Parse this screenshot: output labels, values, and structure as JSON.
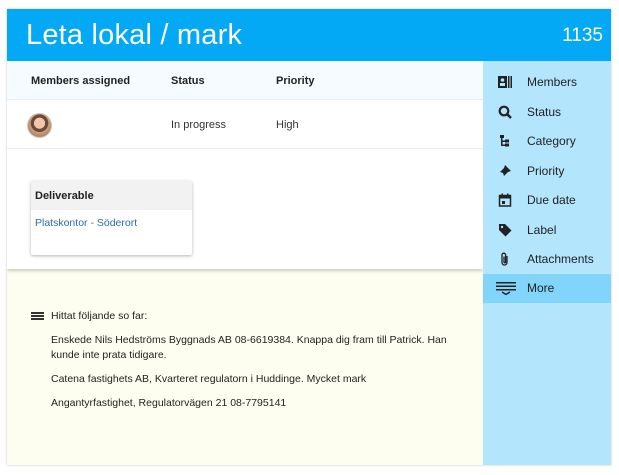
{
  "header": {
    "title": "Leta lokal / mark",
    "ticket_id": "1135"
  },
  "table": {
    "columns": [
      "Members assigned",
      "Status",
      "Priority"
    ],
    "row": {
      "status": "In progress",
      "priority": "High"
    }
  },
  "deliverable": {
    "heading": "Deliverable",
    "link": "Platskontor - Söderort"
  },
  "description": {
    "title": "Hittat följande so far:",
    "paragraphs": [
      "Enskede Nils Hedströms Byggnads AB 08-6619384. Knappa dig fram till Patrick. Han kunde inte prata tidigare.",
      "Catena fastighets AB, Kvarteret regulatorn i Huddinge. Mycket mark",
      "Angantyrfastighet, Regulatorvägen 21 08-7795141"
    ]
  },
  "sidebar": {
    "items": [
      {
        "label": "Members",
        "icon": "members-icon"
      },
      {
        "label": "Status",
        "icon": "search-icon"
      },
      {
        "label": "Category",
        "icon": "category-icon"
      },
      {
        "label": "Priority",
        "icon": "pin-icon"
      },
      {
        "label": "Due date",
        "icon": "calendar-icon"
      },
      {
        "label": "Label",
        "icon": "tag-icon"
      },
      {
        "label": "Attachments",
        "icon": "paperclip-icon"
      },
      {
        "label": "More",
        "icon": "more-icon"
      }
    ],
    "active_index": 7
  },
  "colors": {
    "header": "#03a9f4",
    "sidebar": "#b3e5fc",
    "sidebar_active": "#81d4fa",
    "body": "#fefef0"
  }
}
